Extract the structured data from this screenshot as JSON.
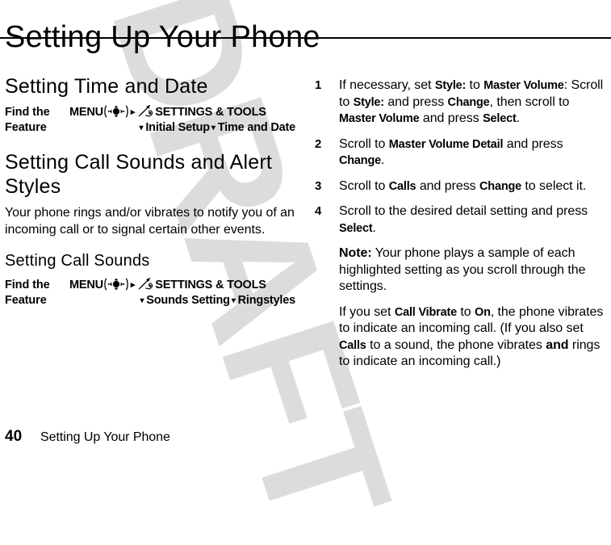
{
  "document": {
    "chapter_title": "Setting Up Your Phone",
    "watermark": "DRAFT",
    "watermark_color": "#dcdcdc",
    "text_color": "#000000",
    "background_color": "#ffffff"
  },
  "left_column": {
    "section1": {
      "heading": "Setting Time and Date",
      "find_feature": {
        "label_line1": "Find the",
        "label_line2": "Feature",
        "menu_word": "MENU",
        "navpad_icon": "navigation-pad-icon",
        "arrow_right": "▸",
        "tools_icon": "settings-tools-icon",
        "destination": "SETTINGS & TOOLS",
        "arrow_down": "▾",
        "path_item1": "Initial Setup",
        "path_item2": "Time and Date"
      }
    },
    "section2": {
      "heading": "Setting Call Sounds and Alert Styles",
      "paragraph": "Your phone rings and/or vibrates to notify you of an incoming call or to signal certain other events."
    },
    "section3": {
      "heading": "Setting Call Sounds",
      "find_feature": {
        "label_line1": "Find the",
        "label_line2": "Feature",
        "menu_word": "MENU",
        "navpad_icon": "navigation-pad-icon",
        "arrow_right": "▸",
        "tools_icon": "settings-tools-icon",
        "destination": "SETTINGS & TOOLS",
        "arrow_down": "▾",
        "path_item1": "Sounds Setting",
        "path_item2": "Ringstyles"
      }
    }
  },
  "right_column": {
    "steps": [
      {
        "number": "1",
        "parts": [
          {
            "t": "If necessary, set ",
            "b": false
          },
          {
            "t": "Style:",
            "b": true
          },
          {
            "t": " to ",
            "b": false
          },
          {
            "t": "Master Volume",
            "b": true
          },
          {
            "t": ": Scroll to ",
            "b": false
          },
          {
            "t": "Style:",
            "b": true
          },
          {
            "t": " and press ",
            "b": false
          },
          {
            "t": "Change",
            "b": true
          },
          {
            "t": ", then scroll to ",
            "b": false
          },
          {
            "t": "Master Volume",
            "b": true
          },
          {
            "t": " and press ",
            "b": false
          },
          {
            "t": "Select",
            "b": true
          },
          {
            "t": ".",
            "b": false
          }
        ]
      },
      {
        "number": "2",
        "parts": [
          {
            "t": "Scroll to ",
            "b": false
          },
          {
            "t": "Master Volume Detail",
            "b": true
          },
          {
            "t": " and press ",
            "b": false
          },
          {
            "t": "Change",
            "b": true
          },
          {
            "t": ".",
            "b": false
          }
        ]
      },
      {
        "number": "3",
        "parts": [
          {
            "t": "Scroll to ",
            "b": false
          },
          {
            "t": "Calls",
            "b": true
          },
          {
            "t": " and press ",
            "b": false
          },
          {
            "t": "Change",
            "b": true
          },
          {
            "t": " to select it.",
            "b": false
          }
        ]
      },
      {
        "number": "4",
        "parts": [
          {
            "t": "Scroll to the desired detail setting and press ",
            "b": false
          },
          {
            "t": "Select",
            "b": true
          },
          {
            "t": ".",
            "b": false
          }
        ]
      }
    ],
    "note": {
      "lead": "Note:",
      "text": " Your phone plays a sample of each highlighted setting as you scroll through the settings."
    },
    "vibrate_paragraph": [
      {
        "t": "If you set ",
        "b": false,
        "em": false
      },
      {
        "t": "Call Vibrate",
        "b": true,
        "em": false
      },
      {
        "t": " to ",
        "b": false,
        "em": false
      },
      {
        "t": "On",
        "b": true,
        "em": false
      },
      {
        "t": ", the phone vibrates to indicate an incoming call. (If you also set ",
        "b": false,
        "em": false
      },
      {
        "t": "Calls",
        "b": true,
        "em": false
      },
      {
        "t": " to a sound, the phone vibrates ",
        "b": false,
        "em": false
      },
      {
        "t": "and",
        "b": false,
        "em": true
      },
      {
        "t": " rings to indicate an incoming call.)",
        "b": false,
        "em": false
      }
    ]
  },
  "footer": {
    "page_number": "40",
    "title": "Setting Up Your Phone"
  }
}
